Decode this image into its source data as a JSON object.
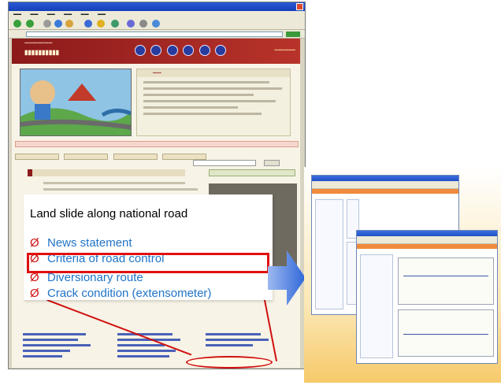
{
  "left_window": {
    "icons": {
      "back": "back-arrow-icon",
      "forward": "forward-arrow-icon",
      "search": "search-icon",
      "favorites": "star-icon"
    }
  },
  "callout": {
    "title": "Land slide along national road",
    "bullet_symbol": "Ø",
    "items": [
      "News statement",
      "Criteria of road control",
      "Diversionary route",
      "Crack condition (extensometer)"
    ],
    "highlighted_index": 2
  },
  "colors": {
    "bullet": "#d01010",
    "item_text": "#1f73c7",
    "highlight_border": "#e01010",
    "arrow": "#2f66d8",
    "header": "#8b1a1a"
  }
}
